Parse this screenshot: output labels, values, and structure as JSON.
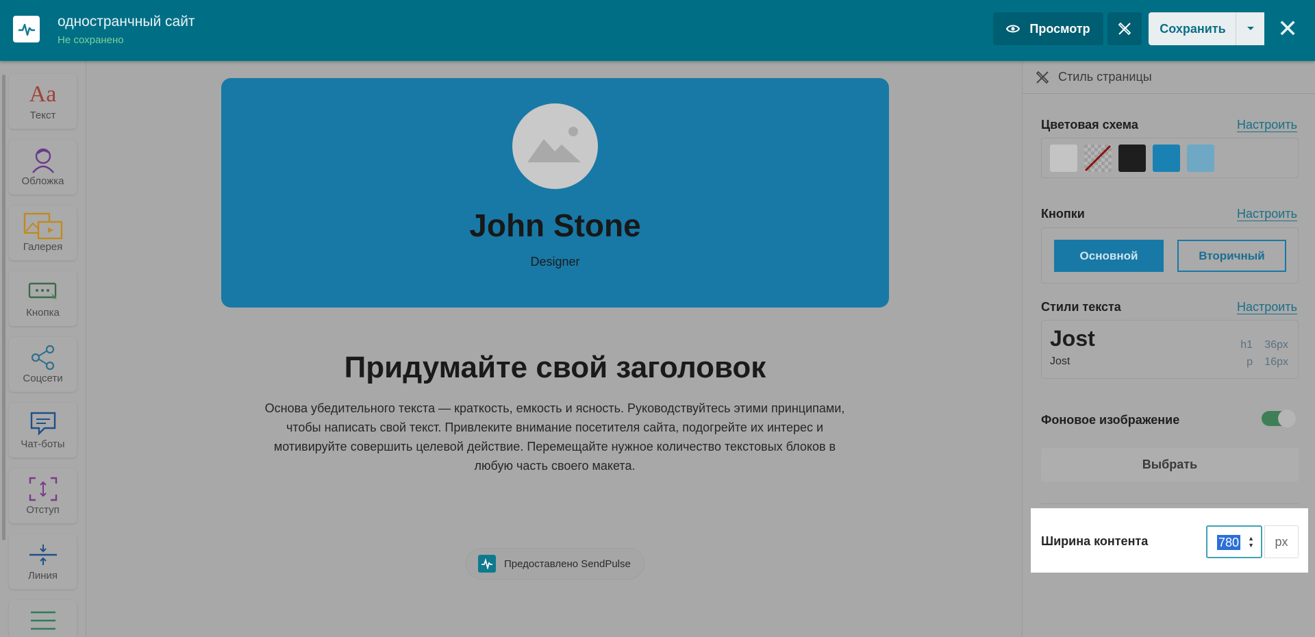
{
  "header": {
    "title": "одностранчный сайт",
    "status": "Не сохранено",
    "preview_label": "Просмотр",
    "save_label": "Сохранить"
  },
  "sidebar": {
    "tools": [
      {
        "label": "Текст",
        "icon": "text-aa-icon"
      },
      {
        "label": "Обложка",
        "icon": "cover-avatar-icon"
      },
      {
        "label": "Галерея",
        "icon": "gallery-icon"
      },
      {
        "label": "Кнопка",
        "icon": "button-icon"
      },
      {
        "label": "Соцсети",
        "icon": "share-icon"
      },
      {
        "label": "Чат-боты",
        "icon": "chat-icon"
      },
      {
        "label": "Отступ",
        "icon": "spacing-icon"
      },
      {
        "label": "Линия",
        "icon": "line-icon"
      },
      {
        "label": "",
        "icon": "menu-icon"
      }
    ]
  },
  "canvas": {
    "name": "John Stone",
    "role": "Designer",
    "headline": "Придумайте свой заголовок",
    "body": "Основа убедительного текста — краткость, емкость и ясность. Руководствуйтесь этими принципами, чтобы написать свой текст. Привлеките внимание посетителя сайта, подогрейте их интерес и мотивируйте совершить целевой действие. Перемещайте нужное количество текстовых блоков в любую часть своего макета.",
    "badge": "Предоставлено SendPulse",
    "hero_color": "#1879a6"
  },
  "panel": {
    "title": "Стиль страницы",
    "color_scheme": {
      "title": "Цветовая схема",
      "configure": "Настроить",
      "swatches": [
        "#c4c4c4",
        "transparent",
        "#1e1e1e",
        "#1a82b3",
        "#6ea8c4"
      ]
    },
    "buttons": {
      "title": "Кнопки",
      "configure": "Настроить",
      "primary": "Основной",
      "secondary": "Вторичный"
    },
    "text_styles": {
      "title": "Стили текста",
      "configure": "Настроить",
      "h_font": "Jost",
      "p_font": "Jost",
      "h_spec_tag": "h1",
      "h_spec_size": "36px",
      "p_spec_tag": "p",
      "p_spec_size": "16px"
    },
    "background": {
      "title": "Фоновое изображение",
      "enabled": true,
      "choose_label": "Выбрать"
    },
    "content_width": {
      "label": "Ширина контента",
      "value": "780",
      "unit": "px"
    }
  }
}
